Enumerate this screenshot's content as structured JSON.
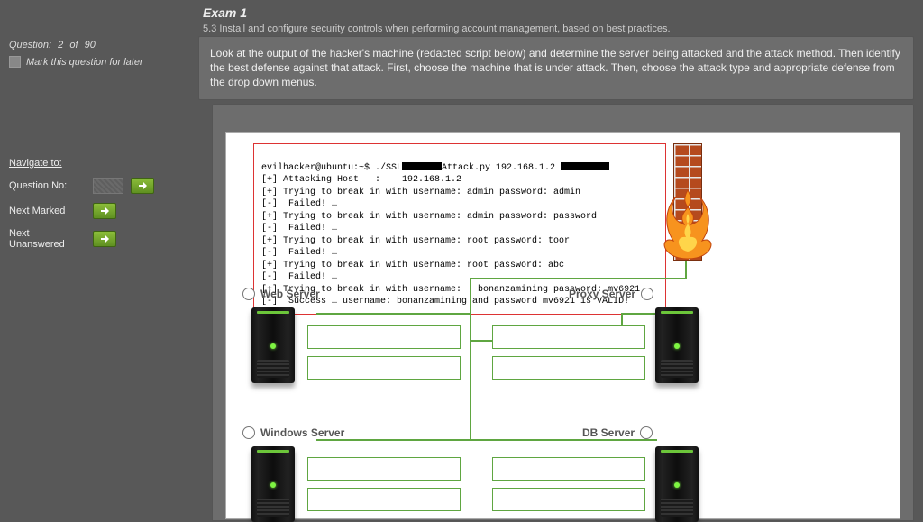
{
  "header": {
    "title": "Exam 1",
    "subtitle": "5.3 Install and configure security controls when performing account management, based on best practices."
  },
  "question_text": "Look at the output of the hacker's machine (redacted script below) and determine the server being attacked and the attack method. Then identify the best defense against that attack. First, choose the machine that is under attack. Then, choose the attack type and appropriate defense from the drop down menus.",
  "sidebar": {
    "question_label": "Question:",
    "question_num": "2",
    "of_label": "of",
    "question_total": "90",
    "mark_label": "Mark this question for later",
    "nav_head": "Navigate to:",
    "qno_label": "Question No:",
    "next_marked": "Next Marked",
    "next_unanswered": "Next Unanswered"
  },
  "terminal": {
    "l1a": "evilhacker@ubuntu:~$ ./SSL",
    "l1b": "Attack.py 192.168.1.2 ",
    "l2": "[+] Attacking Host   :    192.168.1.2",
    "l3": "[+] Trying to break in with username: admin password: admin",
    "l4": "[-]  Failed! …",
    "l5": "[+] Trying to break in with username: admin password: password",
    "l6": "[-]  Failed! …",
    "l7": "[+] Trying to break in with username: root password: toor",
    "l8": "[-]  Failed! …",
    "l9": "[+] Trying to break in with username: root password: abc",
    "l10": "[-]  Failed! …",
    "l11": "[+] Trying to break in with username:   bonanzamining password: mv6921",
    "l12": "[-]  Success … username: bonanzamining and password mv6921 is VALID!"
  },
  "nodes": {
    "web": "Web Server",
    "proxy": "Proxy Server",
    "windows": "Windows Server",
    "db": "DB Server"
  }
}
